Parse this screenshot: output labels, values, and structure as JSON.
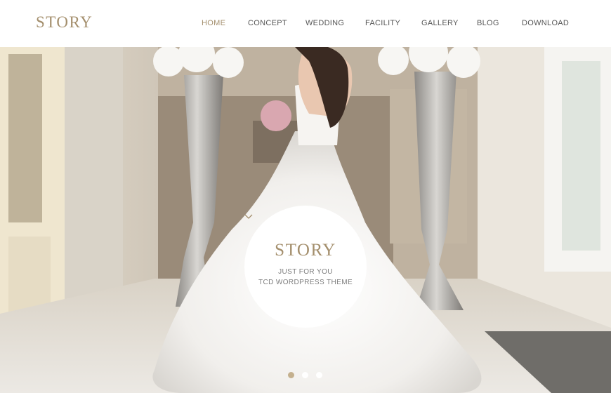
{
  "brand": {
    "logo_text": "STORY",
    "accent_color": "#a48f6d"
  },
  "nav": {
    "items": [
      {
        "label": "HOME",
        "active": true
      },
      {
        "label": "CONCEPT",
        "active": false
      },
      {
        "label": "WEDDING",
        "active": false
      },
      {
        "label": "FACILITY",
        "active": false
      },
      {
        "label": "GALLERY",
        "active": false
      },
      {
        "label": "BLOG",
        "active": false
      },
      {
        "label": "DOWNLOAD",
        "active": false
      }
    ]
  },
  "hero": {
    "image": "bride-in-white-wedding-dress-holding-bouquet",
    "title": "STORY",
    "subtitle_line1": "JUST FOR YOU",
    "subtitle_line2": "TCD WORDPRESS THEME",
    "scroll_icon": "chevron-down-icon"
  },
  "slider": {
    "slide_count": 3,
    "active_index": 0
  }
}
